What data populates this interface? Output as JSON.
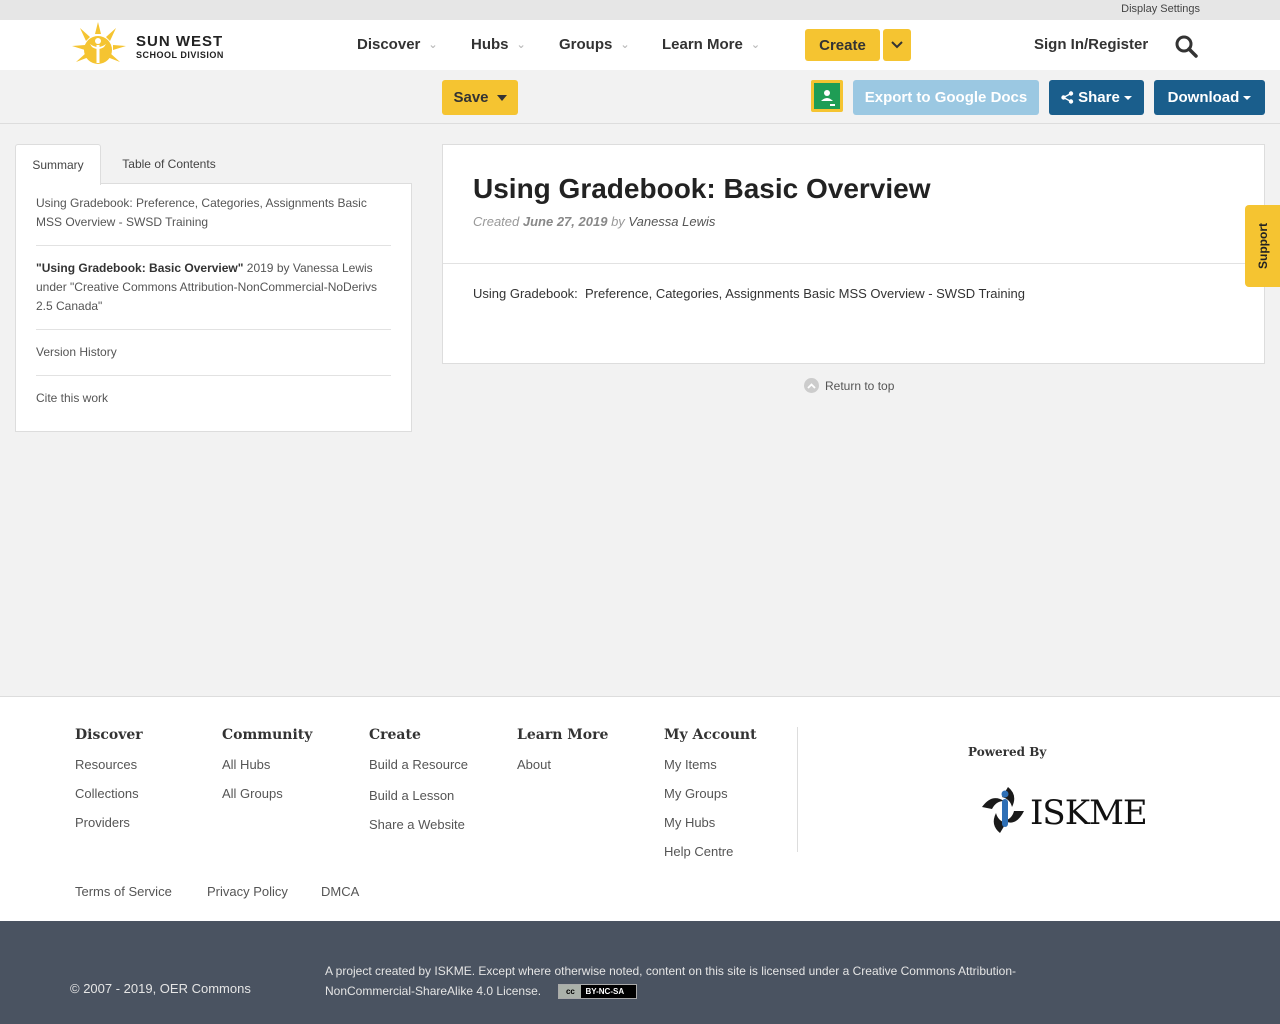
{
  "topbar": {
    "display_settings": "Display Settings"
  },
  "header": {
    "logo_line1": "SUN WEST",
    "logo_line2": "SCHOOL DIVISION",
    "nav": [
      "Discover",
      "Hubs",
      "Groups",
      "Learn More"
    ],
    "create_label": "Create",
    "signin_label": "Sign In/Register"
  },
  "toolbar": {
    "save_label": "Save",
    "export_label": "Export to Google Docs",
    "share_label": "Share",
    "download_label": "Download"
  },
  "tabs": {
    "summary": "Summary",
    "toc": "Table of Contents"
  },
  "sidebar": {
    "description": "Using Gradebook: Preference, Categories, Assignments Basic MSS Overview - SWSD Training",
    "attribution_title": "\"Using Gradebook: Basic Overview\"",
    "attribution_rest": " 2019 by Vanessa Lewis under \"Creative Commons Attribution-NonCommercial-NoDerivs 2.5 Canada\"",
    "version_history": "Version History",
    "cite": "Cite this work"
  },
  "content": {
    "title": "Using Gradebook: Basic Overview",
    "created_prefix": "Created",
    "created_date": "June 27, 2019",
    "by": "by",
    "author": "Vanessa Lewis",
    "summary": "Using Gradebook:  Preference, Categories, Assignments Basic MSS Overview - SWSD Training",
    "return_top": "Return to top"
  },
  "support_label": "Support",
  "footer": {
    "discover": {
      "heading": "Discover",
      "links": [
        "Resources",
        "Collections",
        "Providers"
      ]
    },
    "community": {
      "heading": "Community",
      "links": [
        "All Hubs",
        "All Groups"
      ]
    },
    "create": {
      "heading": "Create",
      "links": [
        "Build a Resource",
        "Build a Lesson",
        "Share a Website"
      ]
    },
    "learn": {
      "heading": "Learn More",
      "links": [
        "About"
      ]
    },
    "account": {
      "heading": "My Account",
      "links": [
        "My Items",
        "My Groups",
        "My Hubs",
        "Help Centre"
      ]
    },
    "powered_by": "Powered By",
    "iskme_logo": "ISKME",
    "legal": [
      "Terms of Service",
      "Privacy Policy",
      "DMCA"
    ]
  },
  "bottom": {
    "copyright": "© 2007 - 2019, OER Commons",
    "project": "A project created by ISKME. Except where otherwise noted, content on this site is licensed under a Creative Commons Attribution-NonCommercial-ShareAlike 4.0 License.",
    "cc_badge": "BY-NC-SA",
    "cc_mark": "cc"
  },
  "colors": {
    "accent_yellow": "#f5c431",
    "brand_blue": "#1a5e8c",
    "export_blue": "#9bc8e2",
    "footer_dark": "#4a5361"
  }
}
